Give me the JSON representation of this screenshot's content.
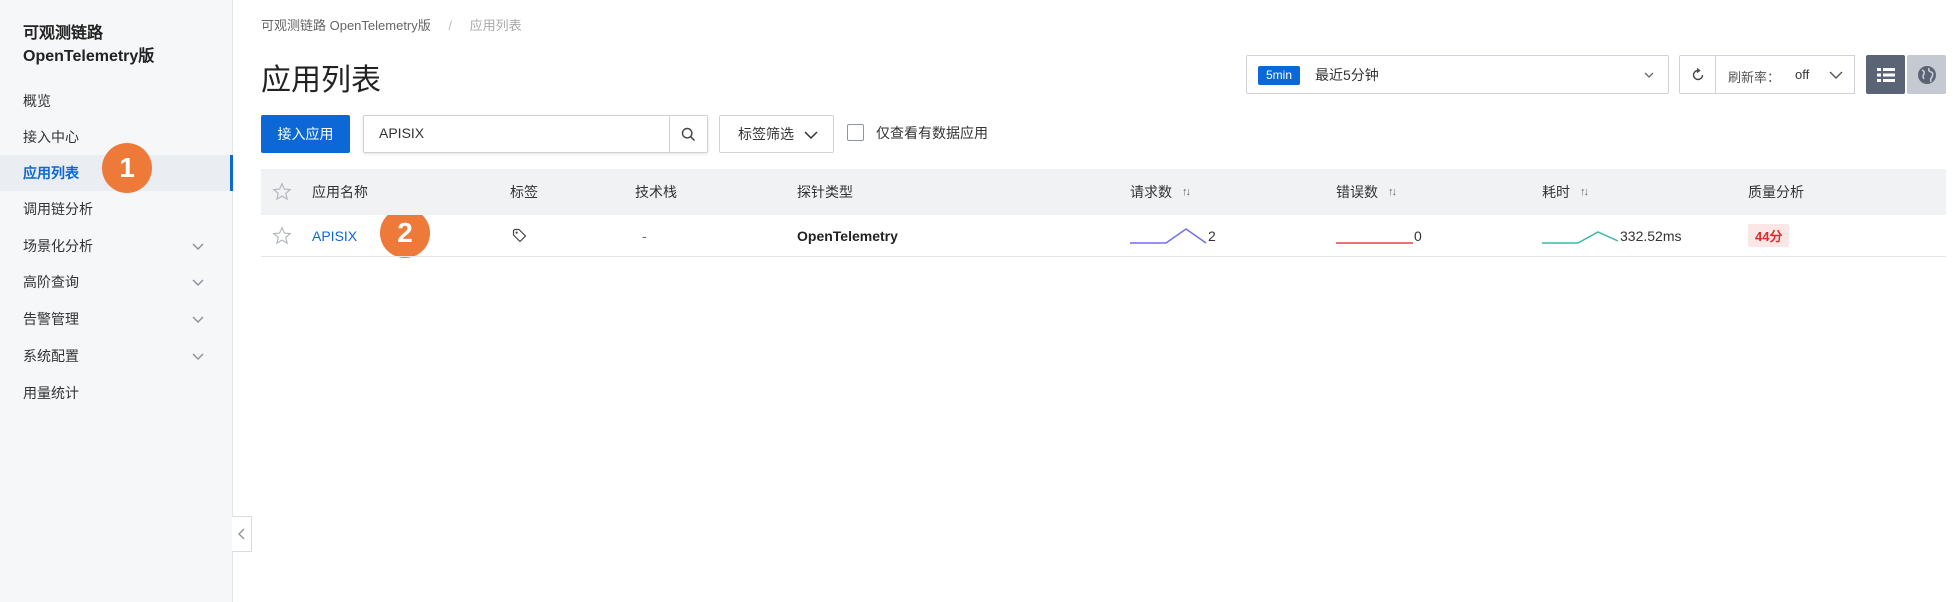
{
  "sidebar": {
    "title_line1": "可观测链路",
    "title_line2": "OpenTelemetry版",
    "items": [
      {
        "label": "概览",
        "has_chevron": false,
        "active": false
      },
      {
        "label": "接入中心",
        "has_chevron": false,
        "active": false
      },
      {
        "label": "应用列表",
        "has_chevron": false,
        "active": true
      },
      {
        "label": "调用链分析",
        "has_chevron": false,
        "active": false
      },
      {
        "label": "场景化分析",
        "has_chevron": true,
        "active": false
      },
      {
        "label": "高阶查询",
        "has_chevron": true,
        "active": false
      },
      {
        "label": "告警管理",
        "has_chevron": true,
        "active": false
      },
      {
        "label": "系统配置",
        "has_chevron": true,
        "active": false
      },
      {
        "label": "用量统计",
        "has_chevron": false,
        "active": false
      }
    ]
  },
  "annotations": {
    "badge1": "1",
    "badge2": "2"
  },
  "breadcrumb": {
    "parent": "可观测链路 OpenTelemetry版",
    "separator": "/",
    "current": "应用列表"
  },
  "page_title": "应用列表",
  "time_range": {
    "tag": "5min",
    "label": "最近5分钟"
  },
  "refresh_rate": {
    "label": "刷新率：",
    "value": "off"
  },
  "toolbar": {
    "add_app_label": "接入应用",
    "search_value": "APISIX",
    "tag_filter_label": "标签筛选",
    "only_data_label": "仅查看有数据应用"
  },
  "table": {
    "headers": {
      "name": "应用名称",
      "tags": "标签",
      "stack": "技术栈",
      "probe": "探针类型",
      "requests": "请求数",
      "errors": "错误数",
      "latency": "耗时",
      "quality": "质量分析"
    },
    "sort_glyph": "↑↓",
    "rows": [
      {
        "name": "APISIX",
        "stack": "-",
        "probe": "OpenTelemetry",
        "requests": "2",
        "errors": "0",
        "latency": "332.52ms",
        "quality": "44分"
      }
    ]
  },
  "colors": {
    "accent": "#0b68d6",
    "requests_spark": "#6f6ff0",
    "errors_spark": "#e0464a",
    "latency_spark": "#3bb8a8",
    "badge": "#ee7a3a"
  }
}
